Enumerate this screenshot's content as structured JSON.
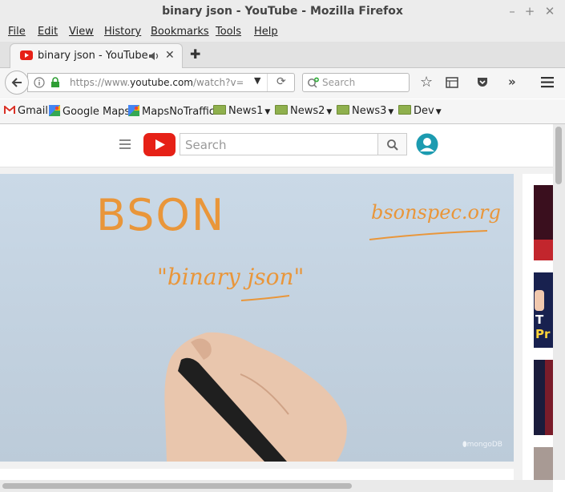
{
  "window": {
    "title": "binary json - YouTube - Mozilla Firefox"
  },
  "menu": [
    "File",
    "Edit",
    "View",
    "History",
    "Bookmarks",
    "Tools",
    "Help"
  ],
  "tab": {
    "title": "binary json - YouTube"
  },
  "nav": {
    "url_prefix": "https://www.",
    "url_domain": "youtube.com",
    "url_rest": "/watch?v=BfWn",
    "search_placeholder": "Search"
  },
  "bookmarks": [
    {
      "label": "Gmail",
      "type": "gmail-icon"
    },
    {
      "label": "Google Maps",
      "type": "maps-icon"
    },
    {
      "label": "MapsNoTraffic",
      "type": "maps-icon"
    },
    {
      "label": "News1",
      "type": "folder-icon"
    },
    {
      "label": "News2",
      "type": "folder-icon"
    },
    {
      "label": "News3",
      "type": "folder-icon"
    },
    {
      "label": "Dev",
      "type": "folder-icon"
    }
  ],
  "youtube": {
    "search_placeholder": "Search"
  },
  "video": {
    "handwriting_title": "BSON",
    "handwriting_site": "bsonspec.org",
    "handwriting_subtitle": "\"binary json\"",
    "watermark": "mongoDB"
  },
  "colors": {
    "youtube_red": "#e62117",
    "handwriting_orange": "#e9963a",
    "video_bg": "#c5d4e2",
    "avatar_teal": "#1c9bb0"
  }
}
